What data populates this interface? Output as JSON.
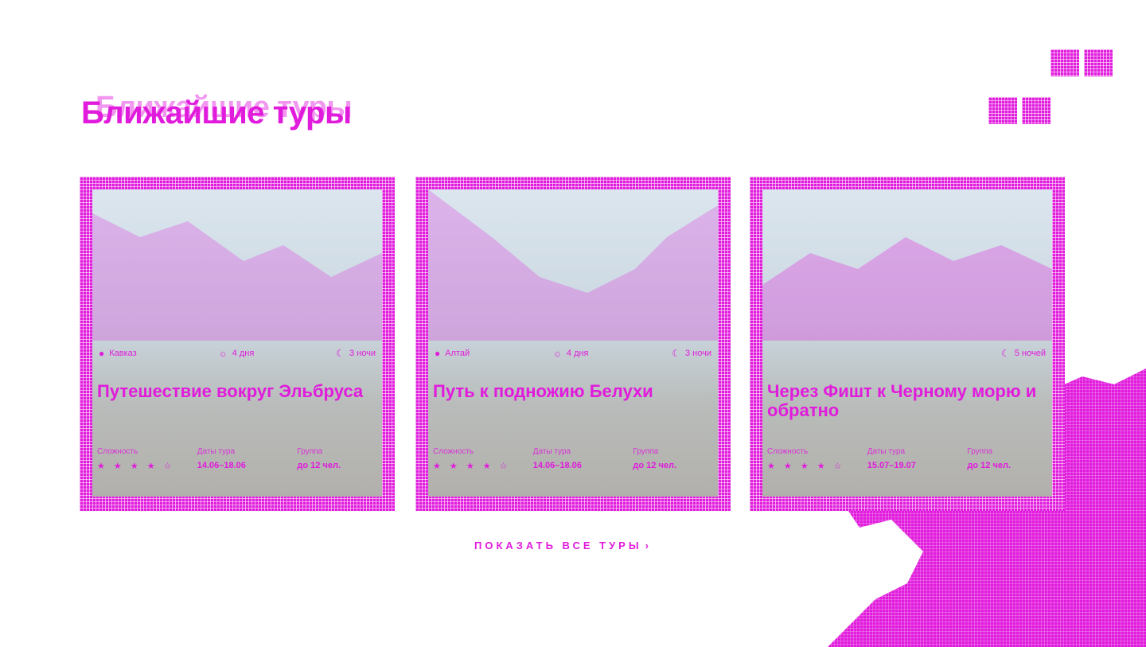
{
  "section": {
    "title": "Ближайшие туры"
  },
  "nav": {
    "prev_icon": "arrow-left-icon",
    "next_icon": "arrow-right-icon"
  },
  "tours": [
    {
      "region": "Кавказ",
      "weather": "4 дня",
      "nights": "3 ночи",
      "title": "Путешествие вокруг Эльбруса",
      "labels": {
        "complexity": "Сложность",
        "dates": "Даты тура",
        "group": "Группа"
      },
      "rating": "★ ★ ★ ★ ☆",
      "dates": "14.06–18.06",
      "group": "до 12 чел."
    },
    {
      "region": "Алтай",
      "weather": "4 дня",
      "nights": "3 ночи",
      "title": "Путь к подножию Белухи",
      "labels": {
        "complexity": "Сложность",
        "dates": "Даты тура",
        "group": "Группа"
      },
      "rating": "★ ★ ★ ★ ☆",
      "dates": "14.06–18.06",
      "group": "до 12 чел."
    },
    {
      "region": "",
      "weather": "",
      "nights": "5 ночей",
      "title": "Через Фишт к Черному морю и обратно",
      "labels": {
        "complexity": "Сложность",
        "dates": "Даты тура",
        "group": "Группа"
      },
      "rating": "★ ★ ★ ★ ☆",
      "dates": "15.07–19.07",
      "group": "до 12 чел."
    }
  ],
  "footer": {
    "show_all": "ПОКАЗАТЬ ВСЕ ТУРЫ",
    "chevron": "›"
  },
  "colors": {
    "accent": "#e11bdc",
    "background": "#ffffff"
  }
}
